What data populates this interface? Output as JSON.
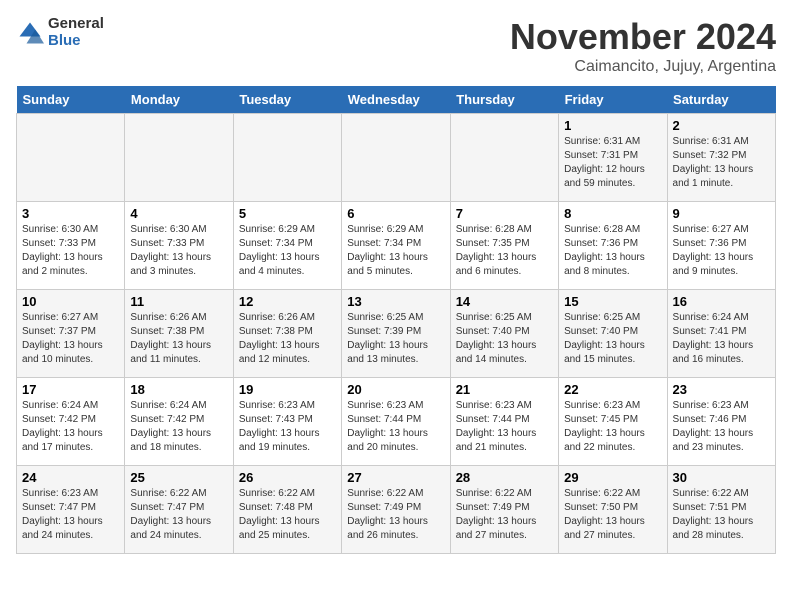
{
  "logo": {
    "general": "General",
    "blue": "Blue"
  },
  "title": "November 2024",
  "location": "Caimancito, Jujuy, Argentina",
  "days_of_week": [
    "Sunday",
    "Monday",
    "Tuesday",
    "Wednesday",
    "Thursday",
    "Friday",
    "Saturday"
  ],
  "weeks": [
    [
      {
        "day": "",
        "info": ""
      },
      {
        "day": "",
        "info": ""
      },
      {
        "day": "",
        "info": ""
      },
      {
        "day": "",
        "info": ""
      },
      {
        "day": "",
        "info": ""
      },
      {
        "day": "1",
        "info": "Sunrise: 6:31 AM\nSunset: 7:31 PM\nDaylight: 12 hours\nand 59 minutes."
      },
      {
        "day": "2",
        "info": "Sunrise: 6:31 AM\nSunset: 7:32 PM\nDaylight: 13 hours\nand 1 minute."
      }
    ],
    [
      {
        "day": "3",
        "info": "Sunrise: 6:30 AM\nSunset: 7:33 PM\nDaylight: 13 hours\nand 2 minutes."
      },
      {
        "day": "4",
        "info": "Sunrise: 6:30 AM\nSunset: 7:33 PM\nDaylight: 13 hours\nand 3 minutes."
      },
      {
        "day": "5",
        "info": "Sunrise: 6:29 AM\nSunset: 7:34 PM\nDaylight: 13 hours\nand 4 minutes."
      },
      {
        "day": "6",
        "info": "Sunrise: 6:29 AM\nSunset: 7:34 PM\nDaylight: 13 hours\nand 5 minutes."
      },
      {
        "day": "7",
        "info": "Sunrise: 6:28 AM\nSunset: 7:35 PM\nDaylight: 13 hours\nand 6 minutes."
      },
      {
        "day": "8",
        "info": "Sunrise: 6:28 AM\nSunset: 7:36 PM\nDaylight: 13 hours\nand 8 minutes."
      },
      {
        "day": "9",
        "info": "Sunrise: 6:27 AM\nSunset: 7:36 PM\nDaylight: 13 hours\nand 9 minutes."
      }
    ],
    [
      {
        "day": "10",
        "info": "Sunrise: 6:27 AM\nSunset: 7:37 PM\nDaylight: 13 hours\nand 10 minutes."
      },
      {
        "day": "11",
        "info": "Sunrise: 6:26 AM\nSunset: 7:38 PM\nDaylight: 13 hours\nand 11 minutes."
      },
      {
        "day": "12",
        "info": "Sunrise: 6:26 AM\nSunset: 7:38 PM\nDaylight: 13 hours\nand 12 minutes."
      },
      {
        "day": "13",
        "info": "Sunrise: 6:25 AM\nSunset: 7:39 PM\nDaylight: 13 hours\nand 13 minutes."
      },
      {
        "day": "14",
        "info": "Sunrise: 6:25 AM\nSunset: 7:40 PM\nDaylight: 13 hours\nand 14 minutes."
      },
      {
        "day": "15",
        "info": "Sunrise: 6:25 AM\nSunset: 7:40 PM\nDaylight: 13 hours\nand 15 minutes."
      },
      {
        "day": "16",
        "info": "Sunrise: 6:24 AM\nSunset: 7:41 PM\nDaylight: 13 hours\nand 16 minutes."
      }
    ],
    [
      {
        "day": "17",
        "info": "Sunrise: 6:24 AM\nSunset: 7:42 PM\nDaylight: 13 hours\nand 17 minutes."
      },
      {
        "day": "18",
        "info": "Sunrise: 6:24 AM\nSunset: 7:42 PM\nDaylight: 13 hours\nand 18 minutes."
      },
      {
        "day": "19",
        "info": "Sunrise: 6:23 AM\nSunset: 7:43 PM\nDaylight: 13 hours\nand 19 minutes."
      },
      {
        "day": "20",
        "info": "Sunrise: 6:23 AM\nSunset: 7:44 PM\nDaylight: 13 hours\nand 20 minutes."
      },
      {
        "day": "21",
        "info": "Sunrise: 6:23 AM\nSunset: 7:44 PM\nDaylight: 13 hours\nand 21 minutes."
      },
      {
        "day": "22",
        "info": "Sunrise: 6:23 AM\nSunset: 7:45 PM\nDaylight: 13 hours\nand 22 minutes."
      },
      {
        "day": "23",
        "info": "Sunrise: 6:23 AM\nSunset: 7:46 PM\nDaylight: 13 hours\nand 23 minutes."
      }
    ],
    [
      {
        "day": "24",
        "info": "Sunrise: 6:23 AM\nSunset: 7:47 PM\nDaylight: 13 hours\nand 24 minutes."
      },
      {
        "day": "25",
        "info": "Sunrise: 6:22 AM\nSunset: 7:47 PM\nDaylight: 13 hours\nand 24 minutes."
      },
      {
        "day": "26",
        "info": "Sunrise: 6:22 AM\nSunset: 7:48 PM\nDaylight: 13 hours\nand 25 minutes."
      },
      {
        "day": "27",
        "info": "Sunrise: 6:22 AM\nSunset: 7:49 PM\nDaylight: 13 hours\nand 26 minutes."
      },
      {
        "day": "28",
        "info": "Sunrise: 6:22 AM\nSunset: 7:49 PM\nDaylight: 13 hours\nand 27 minutes."
      },
      {
        "day": "29",
        "info": "Sunrise: 6:22 AM\nSunset: 7:50 PM\nDaylight: 13 hours\nand 27 minutes."
      },
      {
        "day": "30",
        "info": "Sunrise: 6:22 AM\nSunset: 7:51 PM\nDaylight: 13 hours\nand 28 minutes."
      }
    ]
  ]
}
